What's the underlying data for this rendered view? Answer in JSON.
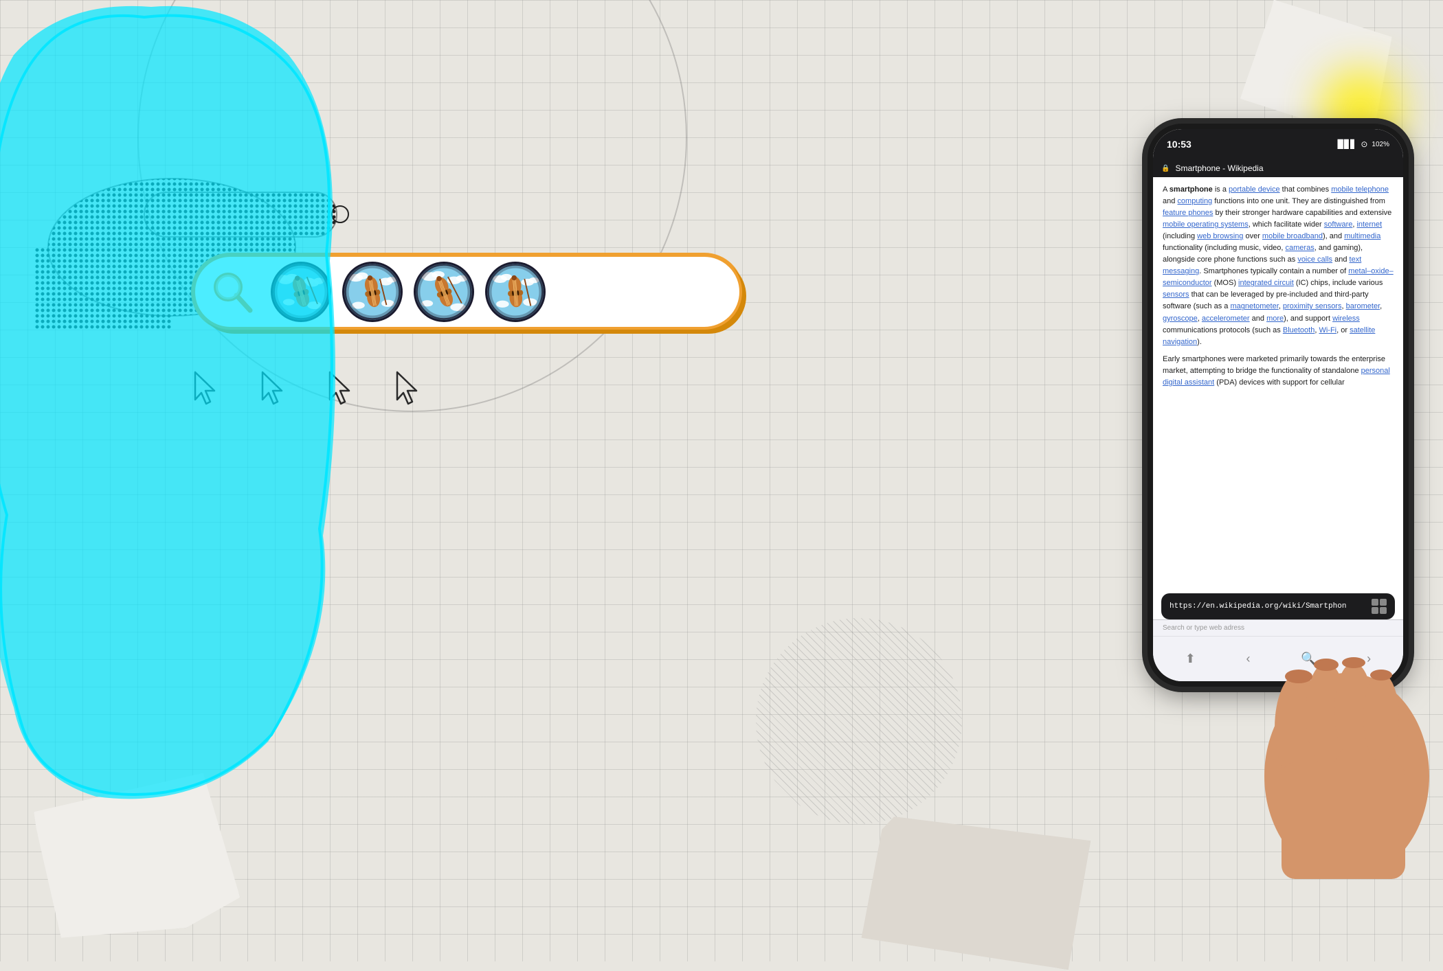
{
  "background": {
    "grid_color": "#c8c5be"
  },
  "search_bar": {
    "placeholder": "Search...",
    "border_color": "#f0a030",
    "shadow_color": "#d4880a"
  },
  "cursors": {
    "count": 4,
    "color": "#2a2a2a"
  },
  "violin_circles": {
    "count": 4,
    "bg_color": "#87CEEB",
    "border_color": "#1a1a2e"
  },
  "phone": {
    "status_time": "10:53",
    "status_battery": "102%",
    "browser_title": "Smartphone - Wikipedia",
    "url": "https://en.wikipedia.org/wiki/Smartphon",
    "search_placeholder": "Search or type web adress",
    "wiki_content": {
      "intro": "A smartphone is a portable device that combines mobile telephone and computing functions into one unit. They are distinguished from feature phones by their stronger hardware capabilities and extensive mobile operating systems, which facilitate wider software, internet (including web browsing over mobile broadband), and multimedia functionality (including music, video, cameras, and gaming), alongside core phone functions such as voice calls and text messaging. Smartphones typically contain a number of metal–oxide–semiconductor (MOS) integrated circuit (IC) chips, include various sensors that can be leveraged by pre-included and third-party software (such as a magnetometer, proximity sensors, barometer, gyroscope, accelerometer and more), and support wireless communications protocols (such as Bluetooth, Wi-Fi, or satellite navigation).",
      "paragraph2": "Early smartphones were marketed primarily towards the enterprise market, attempting to bridge the functionality of standalone personal digital assistant (PDA) devices with support for cellular"
    },
    "lock_icon": "🔒",
    "back_label": "‹",
    "forward_label": "›",
    "share_label": "⬆",
    "search_label": "🔍"
  },
  "decorative": {
    "cyan_glow_color": "#00e5ff",
    "yellow_glow_color": "#ffee00"
  }
}
